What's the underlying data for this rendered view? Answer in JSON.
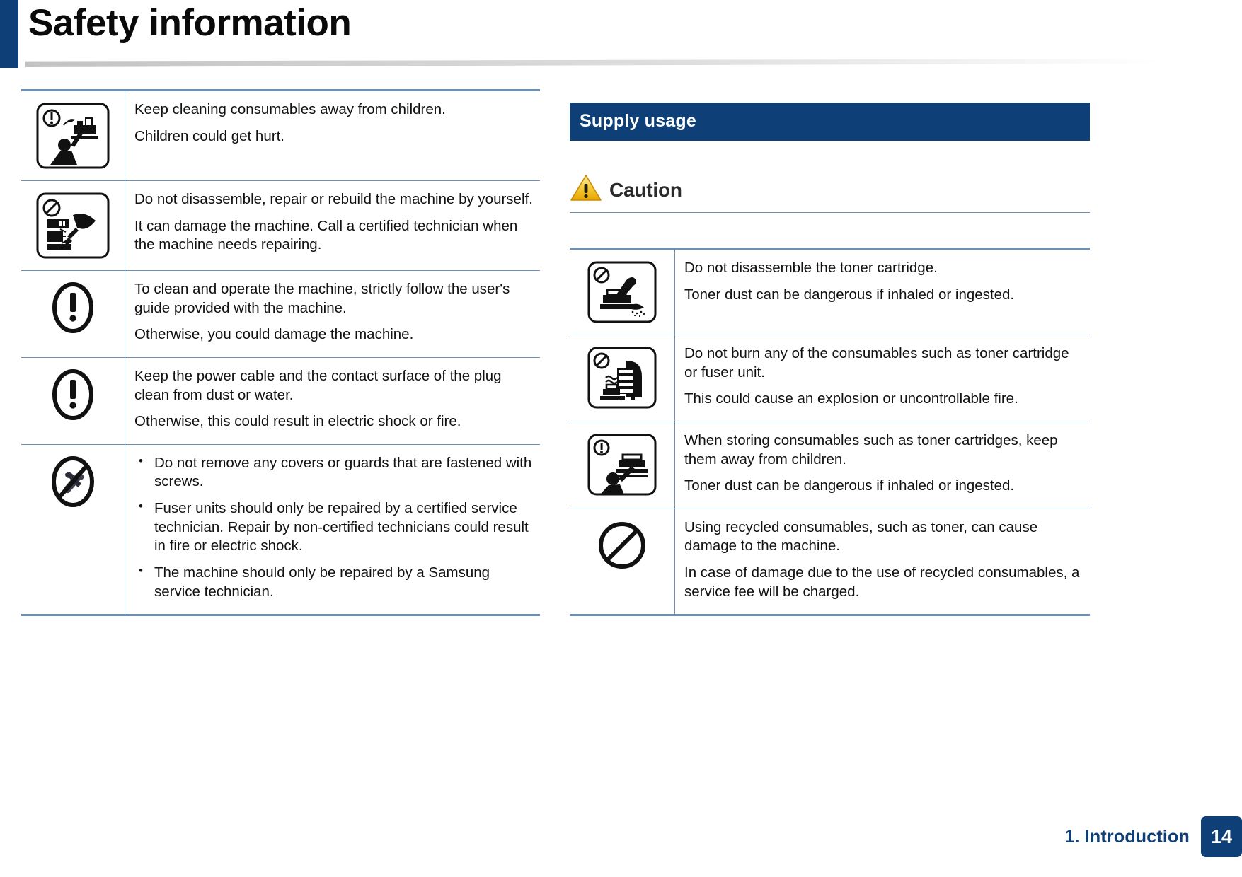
{
  "header": {
    "title": "Safety information",
    "accent_color": "#0e4077"
  },
  "footer": {
    "section_label": "1. Introduction",
    "page_number": "14",
    "color": "#0e4077"
  },
  "left_column": {
    "table_rows": [
      {
        "icon": "keep-away-from-children-icon",
        "lines": [
          "Keep cleaning consumables away from children.",
          "Children could get hurt."
        ]
      },
      {
        "icon": "no-disassemble-machine-icon",
        "lines": [
          "Do not disassemble, repair or rebuild the machine by yourself.",
          "It can damage the machine. Call a certified technician when the machine needs repairing."
        ]
      },
      {
        "icon": "exclamation-mark-icon",
        "lines": [
          "To clean and operate the machine, strictly follow the user's guide provided with the machine.",
          "Otherwise, you could damage the machine."
        ]
      },
      {
        "icon": "exclamation-mark-icon",
        "lines": [
          "Keep the power cable and the contact surface of the plug clean from dust or water.",
          "Otherwise, this could result in electric shock or fire."
        ]
      },
      {
        "icon": "no-tools-icon",
        "bullets": [
          "Do not remove any covers or guards that are fastened with screws.",
          "Fuser units should only be repaired by a certified service technician. Repair by non-certified technicians could result in fire or electric shock.",
          "The machine should only be repaired by a Samsung service technician."
        ]
      }
    ]
  },
  "right_column": {
    "section_heading": "Supply usage",
    "caution": {
      "label": "Caution",
      "icon": "warning-triangle-icon",
      "icon_color": "#f5c226"
    },
    "table_rows": [
      {
        "icon": "no-disassemble-toner-cartridge-icon",
        "lines": [
          "Do not disassemble the toner cartridge.",
          "Toner dust can be dangerous if inhaled or ingested."
        ]
      },
      {
        "icon": "no-burning-consumables-icon",
        "lines": [
          "Do not burn any of the consumables such as toner cartridge or fuser unit.",
          "This could cause an explosion or uncontrollable fire."
        ]
      },
      {
        "icon": "store-away-from-children-icon",
        "lines": [
          "When storing consumables such as toner cartridges, keep them away from children.",
          "Toner dust can be dangerous if inhaled or ingested."
        ]
      },
      {
        "icon": "prohibition-circle-icon",
        "lines": [
          "Using recycled consumables, such as toner, can cause damage to the machine.",
          "In case of damage due to the use of recycled consumables, a service fee will be charged."
        ]
      }
    ]
  },
  "theme": {
    "table_border_color": "#6b8fb5",
    "text_color": "#111111"
  }
}
